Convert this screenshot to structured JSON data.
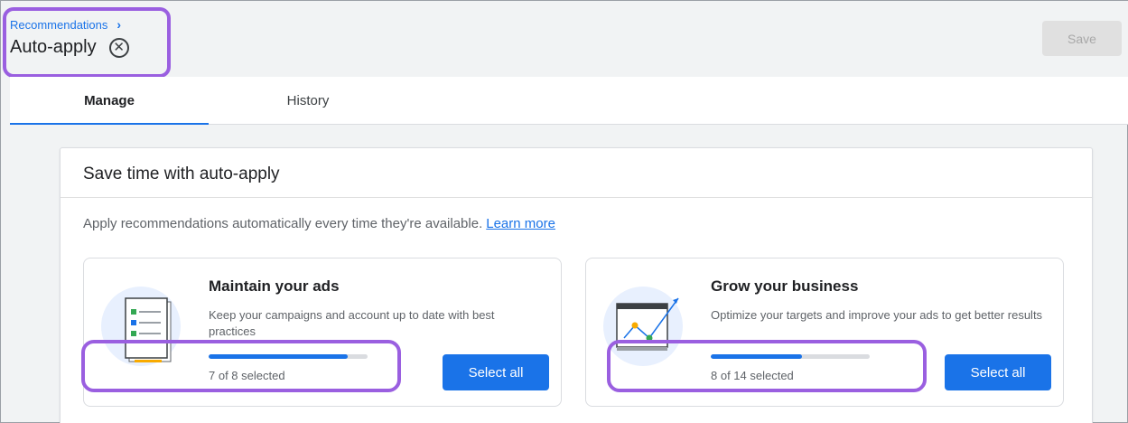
{
  "header": {
    "breadcrumb": "Recommendations",
    "breadcrumb_chevron": "›",
    "title": "Auto-apply",
    "close_icon": "⊗",
    "save_label": "Save"
  },
  "tabs": [
    {
      "label": "Manage",
      "active": true
    },
    {
      "label": "History",
      "active": false
    }
  ],
  "card": {
    "title": "Save time with auto-apply",
    "description": "Apply recommendations automatically every time they're available.",
    "learn_more": "Learn more",
    "sections": [
      {
        "title": "Maintain your ads",
        "description": "Keep your campaigns and account up to date with best practices",
        "selected": 7,
        "total": 8,
        "progress_label": "7 of 8 selected",
        "button_label": "Select all",
        "illustration_icon": "checklist-icon"
      },
      {
        "title": "Grow your business",
        "description": "Optimize your targets and improve your ads to get better results",
        "selected": 8,
        "total": 14,
        "progress_label": "8 of 14 selected",
        "button_label": "Select all",
        "illustration_icon": "growth-chart-icon"
      }
    ]
  },
  "colors": {
    "accent": "#1a73e8",
    "highlight": "#9a5fe0",
    "disabled_button": "#e0e0e0"
  }
}
